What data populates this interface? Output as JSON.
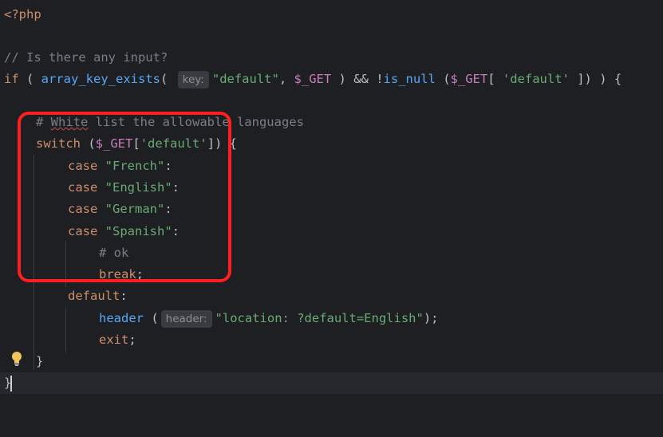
{
  "editor": {
    "language": "php",
    "theme_colors": {
      "background": "#1e1f22",
      "keyword": "#cf8e6d",
      "function": "#56a8f5",
      "string": "#6aab73",
      "variable": "#c77dbb",
      "comment": "#7a7e85",
      "annotation_box": "#ff1f1f"
    },
    "lines": {
      "l1": {
        "open_tag": "<?php"
      },
      "l3": {
        "comment": "// Is there any input?"
      },
      "l4": {
        "if_kw": "if",
        "paren_open": " ( ",
        "fn_array_key_exists": "array_key_exists",
        "paren2": "( ",
        "hint_key": "key:",
        "str_default": "\"default\"",
        "comma": ", ",
        "var_get": "$_GET",
        "and_op": " ) && !",
        "fn_is_null": "is_null",
        "space_paren": " (",
        "var_get2": "$_GET",
        "bracket": "[ ",
        "str_default2": "'default'",
        "close": " ]) ) {"
      },
      "l6": {
        "hash": "# ",
        "word_white": "White",
        "rest": " list the allowable languages"
      },
      "l7": {
        "switch_kw": "switch",
        "open": " (",
        "var": "$_GET",
        "bracket_open": "[",
        "str": "'default'",
        "close": "]) {"
      },
      "l8": {
        "case_kw": "case",
        "str": "\"French\"",
        "colon": ":"
      },
      "l9": {
        "case_kw": "case",
        "str": "\"English\"",
        "colon": ":"
      },
      "l10": {
        "case_kw": "case",
        "str": "\"German\"",
        "colon": ":"
      },
      "l11": {
        "case_kw": "case",
        "str": "\"Spanish\"",
        "colon": ":"
      },
      "l12": {
        "comment": "# ok"
      },
      "l13": {
        "break_kw": "break",
        "semi": ";"
      },
      "l14": {
        "default_kw": "default",
        "colon": ":"
      },
      "l15": {
        "fn_header": "header",
        "open": " (",
        "hint_header": "header:",
        "str": "\"location: ?default=English\"",
        "close": ");"
      },
      "l16": {
        "exit_kw": "exit",
        "semi": ";"
      },
      "l17": {
        "brace": "}"
      },
      "l18": {
        "brace": "}"
      }
    },
    "icons": {
      "intention_bulb": "lightbulb-icon"
    }
  }
}
